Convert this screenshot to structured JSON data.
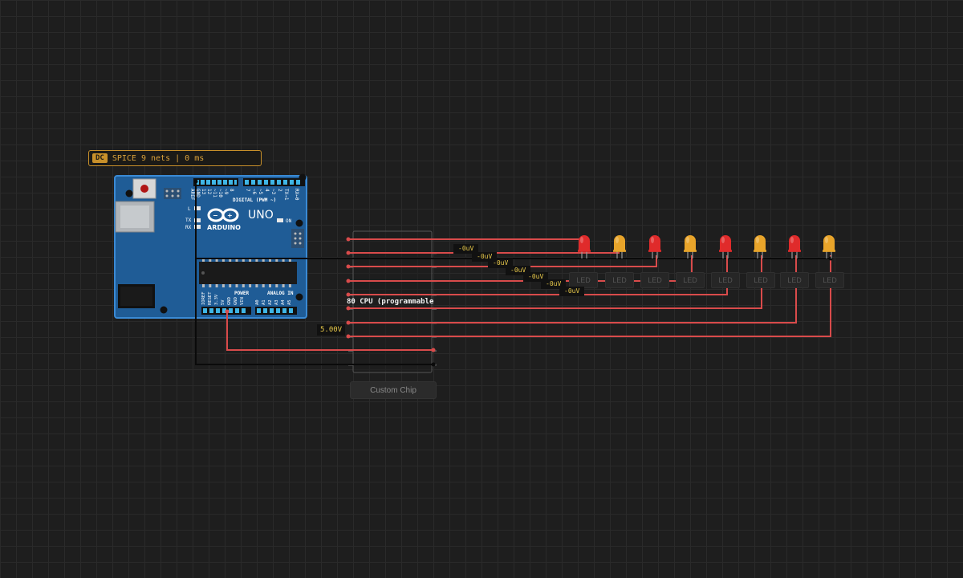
{
  "simulation": {
    "mode_tag": "DC",
    "status": "SPICE 9 nets | 0 ms"
  },
  "arduino": {
    "brand": "ARDUINO",
    "model": "UNO",
    "on_label": "ON",
    "digital_header": "DIGITAL (PWM ~)",
    "power_header": "POWER",
    "analog_header": "ANALOG IN",
    "l_label": "L",
    "tx_label": "TX",
    "rx_label": "RX",
    "top_pins": [
      "AREF",
      "GND",
      "13",
      "12",
      "~11",
      "~10",
      "~9",
      "8",
      "7",
      "~6",
      "~5",
      "4",
      "~3",
      "2",
      "TX→1",
      "RX←0"
    ],
    "power_pins": [
      "IOREF",
      "RESET",
      "3.3V",
      "5V",
      "GND",
      "GND",
      "VIN"
    ],
    "analog_pins": [
      "A0",
      "A1",
      "A2",
      "A3",
      "A4",
      "A5"
    ]
  },
  "custom_chip": {
    "title": "80 CPU (programmable",
    "caption": "Custom Chip"
  },
  "leds": [
    {
      "color": "red",
      "label": "LED"
    },
    {
      "color": "yellow",
      "label": "LED"
    },
    {
      "color": "red",
      "label": "LED"
    },
    {
      "color": "yellow",
      "label": "LED"
    },
    {
      "color": "red",
      "label": "LED"
    },
    {
      "color": "yellow",
      "label": "LED"
    },
    {
      "color": "red",
      "label": "LED"
    },
    {
      "color": "yellow",
      "label": "LED"
    }
  ],
  "voltage_labels": [
    "-0uV",
    "-0uV",
    "-0uV",
    "-0uV",
    "-0uV",
    "-0uV",
    "-0uV"
  ],
  "supply_voltage": "5.00V",
  "colors": {
    "background": "#1e1e1e",
    "wire_signal": "#d94b4b",
    "wire_ground": "#0a0a0a",
    "board_blue": "#1f5c96",
    "led_red": "#e02b2b",
    "led_yellow": "#e8a42a",
    "accent": "#c8902a"
  }
}
